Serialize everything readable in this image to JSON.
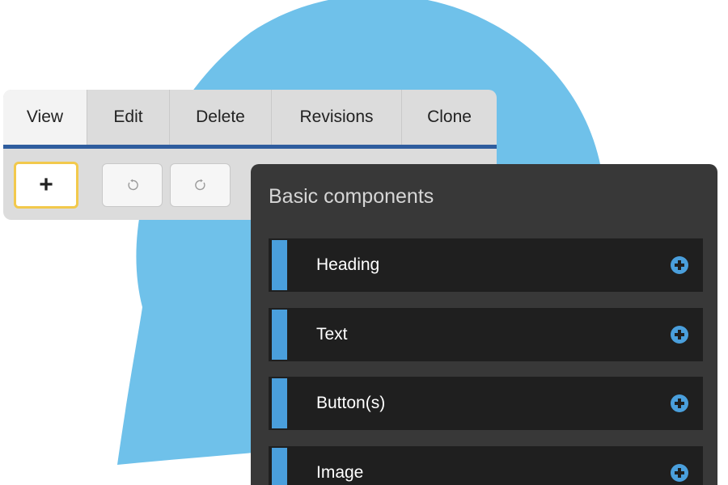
{
  "tabs": [
    {
      "label": "View",
      "active": true
    },
    {
      "label": "Edit",
      "active": false
    },
    {
      "label": "Delete",
      "active": false
    },
    {
      "label": "Revisions",
      "active": false
    },
    {
      "label": "Clone",
      "active": false
    }
  ],
  "toolbar": {
    "add_label": "+",
    "undo_icon": "undo-icon",
    "redo_icon": "redo-icon"
  },
  "components_panel": {
    "title": "Basic components",
    "items": [
      {
        "label": "Heading",
        "icon": "plus-circle-icon"
      },
      {
        "label": "Text",
        "icon": "plus-circle-icon"
      },
      {
        "label": "Button(s)",
        "icon": "plus-circle-icon"
      },
      {
        "label": "Image",
        "icon": "plus-circle-icon"
      }
    ]
  },
  "colors": {
    "bubble_blue": "#6fc1ea",
    "tab_underline": "#2f5d9e",
    "add_button_border": "#f2c94c",
    "panel_background": "#383838",
    "item_background": "#1f1f1f",
    "item_accent": "#4a9fdc",
    "add_icon": "#4a9fdc"
  }
}
